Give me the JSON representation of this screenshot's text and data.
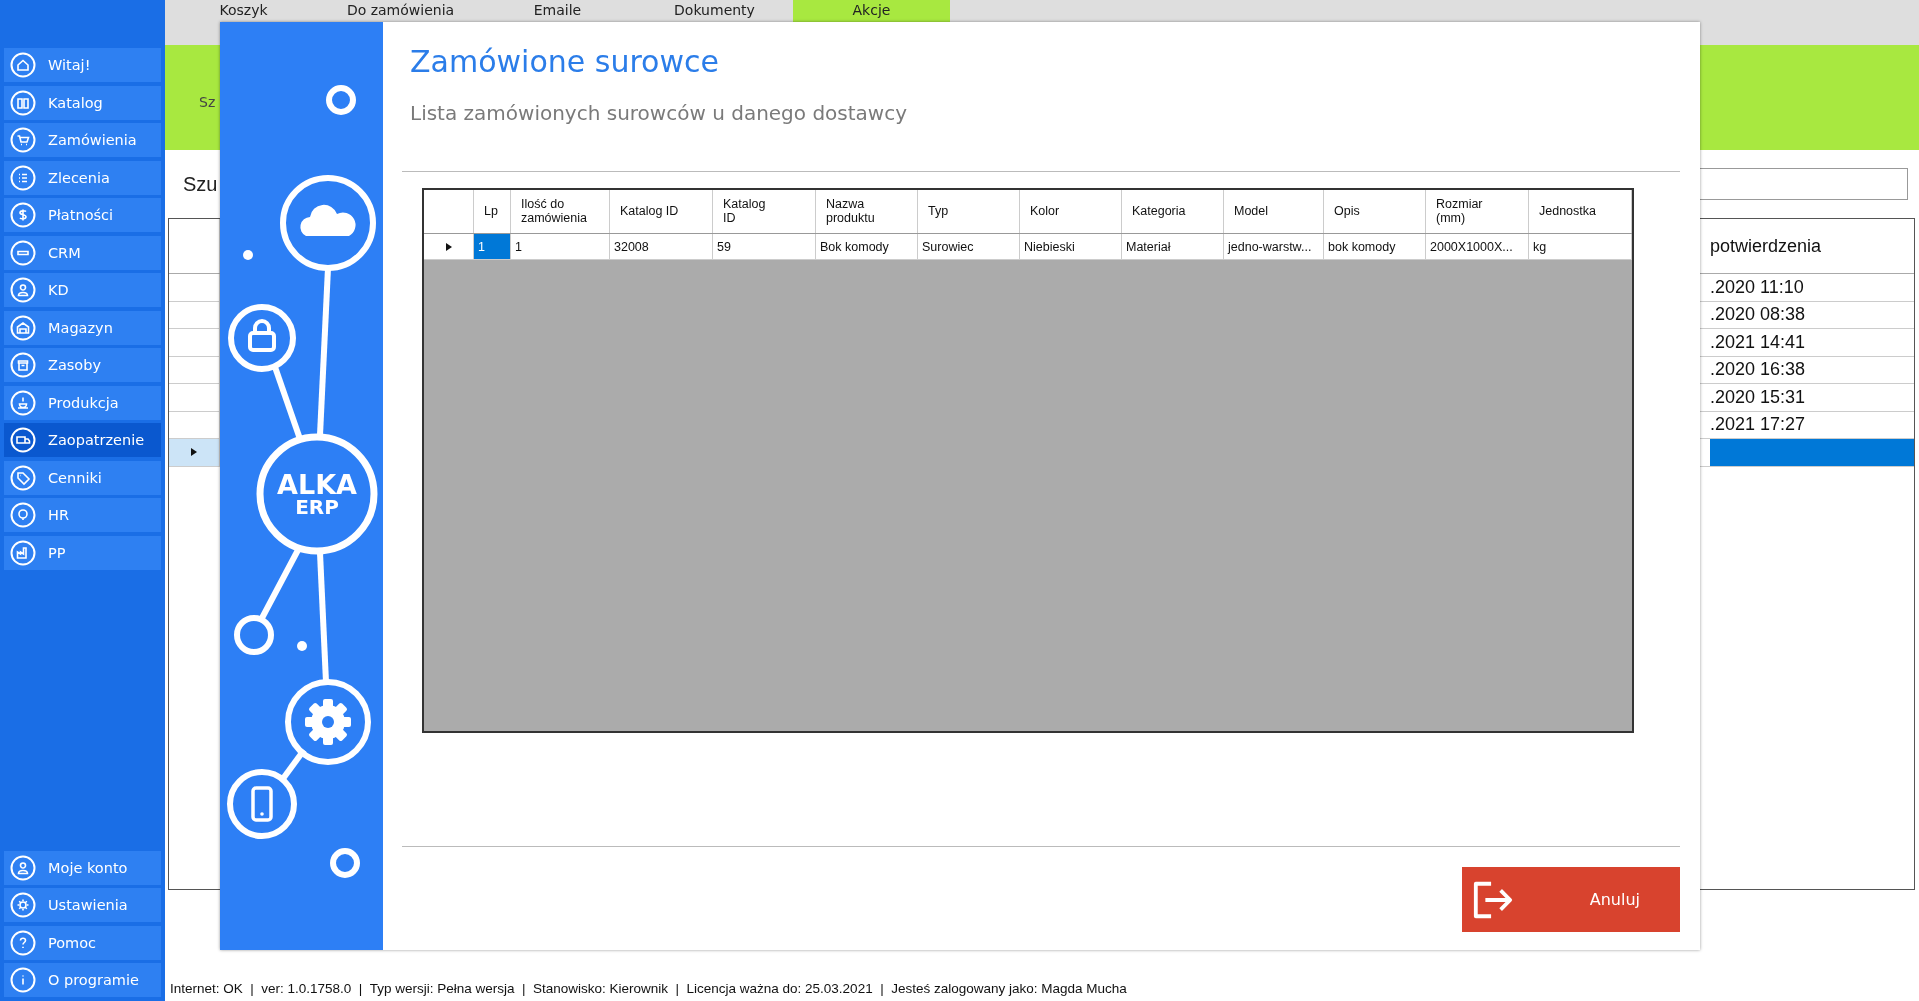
{
  "sidebar": {
    "items": [
      {
        "label": "Witaj!",
        "selected": false
      },
      {
        "label": "Katalog",
        "selected": false
      },
      {
        "label": "Zamówienia",
        "selected": false
      },
      {
        "label": "Zlecenia",
        "selected": false
      },
      {
        "label": "Płatności",
        "selected": false
      },
      {
        "label": "CRM",
        "selected": false
      },
      {
        "label": "KD",
        "selected": false
      },
      {
        "label": "Magazyn",
        "selected": false
      },
      {
        "label": "Zasoby",
        "selected": false
      },
      {
        "label": "Produkcja",
        "selected": false
      },
      {
        "label": "Zaopatrzenie",
        "selected": true
      },
      {
        "label": "Cenniki",
        "selected": false
      },
      {
        "label": "HR",
        "selected": false
      },
      {
        "label": "PP",
        "selected": false
      }
    ],
    "bottom_items": [
      {
        "label": "Moje konto"
      },
      {
        "label": "Ustawienia"
      },
      {
        "label": "Pomoc"
      },
      {
        "label": "O programie"
      }
    ]
  },
  "tabs": [
    {
      "label": "Koszyk",
      "selected": false
    },
    {
      "label": "Do zamówienia",
      "selected": false
    },
    {
      "label": "Emaile",
      "selected": false
    },
    {
      "label": "Dokumenty",
      "selected": false
    },
    {
      "label": "Akcje",
      "selected": true
    }
  ],
  "toolbar": {
    "label": "Sz"
  },
  "search": {
    "label": "Szu"
  },
  "orders_table": {
    "column_header": "potwierdzenia",
    "rows": [
      {
        "date": ".2020 11:10",
        "selected": false
      },
      {
        "date": ".2020 08:38",
        "selected": false
      },
      {
        "date": ".2021 14:41",
        "selected": false
      },
      {
        "date": ".2020 16:38",
        "selected": false
      },
      {
        "date": ".2020 15:31",
        "selected": false
      },
      {
        "date": ".2021 17:27",
        "selected": false
      },
      {
        "selected": true
      }
    ]
  },
  "dialog": {
    "title": "Zamówione surowce",
    "subtitle": "Lista zamówionych surowców u danego dostawcy",
    "logo": [
      "ALKA",
      "ERP"
    ],
    "grid": {
      "columns": [
        "Lp",
        "Ilość do\nzamówienia",
        "Katalog ID",
        "Katalog\nID",
        "Nazwa\nproduktu",
        "Typ",
        "Kolor",
        "Kategoria",
        "Model",
        "Opis",
        "Rozmiar\n(mm)",
        "Jednostka"
      ],
      "rows": [
        {
          "selected": true,
          "cells": [
            "1",
            "1",
            "32008",
            "59",
            "Bok komody",
            "Surowiec",
            "Niebieski",
            "Materiał",
            "jedno-warstw...",
            "bok komody",
            "2000X1000X...",
            "kg"
          ]
        }
      ]
    },
    "cancel_button": "Anuluj"
  },
  "status_bar": "Internet: OK  |  ver: 1.0.1758.0  |  Typ wersji: Pełna wersja  |  Stanowisko: Kierownik  |  Licencja ważna do: 25.03.2021  |  Jesteś zalogowany jako: Magda Mucha"
}
